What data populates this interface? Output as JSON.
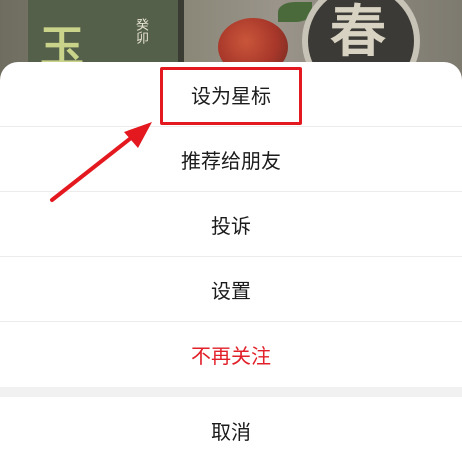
{
  "background": {
    "art_char_left": "玉",
    "art_small_text": "癸卯",
    "art_char_right": "春"
  },
  "action_sheet": {
    "items": [
      {
        "label": "设为星标"
      },
      {
        "label": "推荐给朋友"
      },
      {
        "label": "投诉"
      },
      {
        "label": "设置"
      },
      {
        "label": "不再关注",
        "danger": true
      }
    ],
    "cancel_label": "取消"
  },
  "colors": {
    "danger_text": "#e2202a",
    "annotation_red": "#e3191f",
    "overlay": "#7f7f7f",
    "sheet_bg": "#ffffff"
  },
  "icons": [
    "annotation-arrow-icon"
  ]
}
